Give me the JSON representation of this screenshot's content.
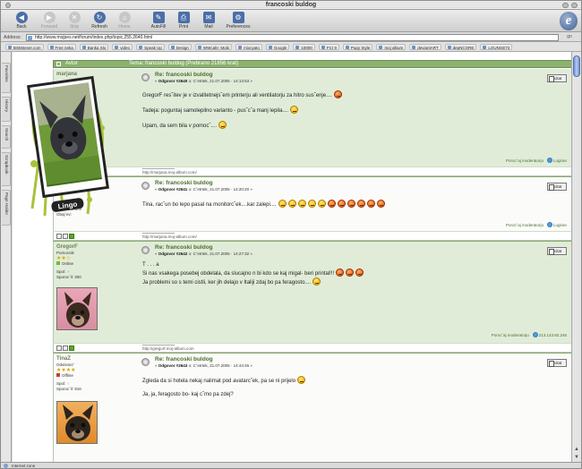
{
  "window": {
    "title": "francoski buldog"
  },
  "toolbar": {
    "buttons": [
      {
        "label": "Back",
        "icon": "back-icon",
        "enabled": true
      },
      {
        "label": "Forward",
        "icon": "forward-icon",
        "enabled": false
      },
      {
        "label": "Stop",
        "icon": "stop-icon",
        "enabled": false
      },
      {
        "label": "Refresh",
        "icon": "refresh-icon",
        "enabled": true
      },
      {
        "label": "Home",
        "icon": "home-icon",
        "enabled": false
      },
      {
        "label": "AutoFill",
        "icon": "autofill-icon",
        "enabled": true
      },
      {
        "label": "Print",
        "icon": "print-icon",
        "enabled": true
      },
      {
        "label": "Mail",
        "icon": "mail-icon",
        "enabled": true
      },
      {
        "label": "Preferences",
        "icon": "preferences-icon",
        "enabled": true
      }
    ]
  },
  "address": {
    "label": "Address:",
    "url": "http://www.mojpes.net/forum/index.php/topic,255.2640.html",
    "go": "go"
  },
  "favorites": [
    "BSM4ever.com",
    "Free neka",
    "Banka Slo",
    "video",
    "Speak Up",
    "Design",
    "WWcafe: Mobi",
    "mixcyato",
    "Google",
    "10000",
    "FCI 9",
    "Pupy Style",
    "moj album",
    "deviantART",
    "depNCORE",
    "LOUNGE72"
  ],
  "sidetabs": [
    "Favorites",
    "History",
    "Search",
    "Scrapbook",
    "Page Holder"
  ],
  "forum": {
    "header": {
      "author": "Avtor",
      "topic": "Tema: francoski buldog  (Prebrano 21856 krat)"
    },
    "posts": [
      {
        "user": "marjana",
        "status": "",
        "rank": "",
        "online": "",
        "posts": "Sporocˇil: 379",
        "avatar_label": "Lingo",
        "title": "Re: francoski buldog",
        "meta_prefix": "«",
        "meta_reply": "Odgovor #2640",
        "meta_rest": "o: Cˇetrtek, 21.07.2005 · 14:13:53 »",
        "lines": [
          "GregorF resˇitev je v izvalitetnejsˇem printerju ali ventilatorju za hitro susˇenje....",
          "Tadeja: poguntaj samolepilno varianto - pusˇcˇa manj lepila....",
          "Upam, da sem bila v pomocˇ...."
        ],
        "modline": "Porocˇaj moderatorju",
        "ip": "Logiran",
        "sig": "http://marjana.moj-album.com/"
      },
      {
        "user": "",
        "title": "Re: francoski buldog",
        "meta_prefix": "«",
        "meta_reply": "Odgovor #2641",
        "meta_rest": "o: Cˇetrtek, 21.07.2005 · 14:20:20 »",
        "lines": [
          "Tina, racˇun bo lepo pasal na monitorcˇek....kar zalepi...."
        ],
        "modline": "Porocˇaj moderatorju",
        "ip": "Logiran",
        "sig": "http://marjana.moj-album.com/",
        "extra": "Obajˇev:"
      },
      {
        "user": "GregorF",
        "status": "Pomocnik",
        "rank": "",
        "online": "Online",
        "posts": "Sporocˇil: 300",
        "spol": "Spol:",
        "title": "Re: francoski buldog",
        "meta_prefix": "«",
        "meta_reply": "Odgovor #2642",
        "meta_rest": "o: Cˇetrtek, 21.07.2005 · 14:27:32 »",
        "lines": [
          "T . . . a",
          "Si nas vsakega posebej obdelala, da slucajno n bi kdo se kaj migal- beri printal!!!",
          "Ja problemi so s temi cistli, ker jih delajo v Italiji zdaj bo pa feragosto...."
        ],
        "modline": "Porocˇaj moderatorju",
        "ip": "213.143.82.246",
        "sig": "http://gregorf.moj-album.com"
      },
      {
        "user": "TinaZ",
        "status": "Odvisnezˇ",
        "rank": "",
        "online": "Offline",
        "posts": "Sporocˇil: 916",
        "spol": "Spol:",
        "title": "Re: francoski buldog",
        "meta_prefix": "«",
        "meta_reply": "Odgovor #2643",
        "meta_rest": "o: Cˇetrtek, 21.07.2005 · 14:44:46 »",
        "lines": [
          "Zgleda da si hotela nekaj nalimat pod avatarcˇek, pa se ni prijelo",
          "Ja, ja, feragosto bo- kaj cˇmo pa zdej?"
        ]
      }
    ],
    "cite_label": "citat"
  },
  "statusbar": {
    "text": "Internet zone"
  },
  "colors": {
    "header_green": "#8cb170",
    "post_alt": "#e1ecd8",
    "title_green": "#4a6e2d"
  }
}
